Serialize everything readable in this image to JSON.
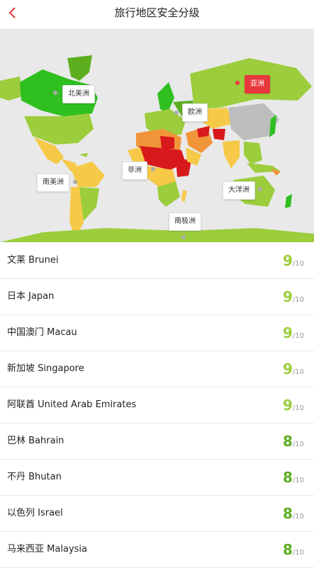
{
  "header": {
    "back_icon": "chevron-left-icon",
    "title": "旅行地区安全分级"
  },
  "colors": {
    "accent": "#e8383d",
    "safe_high": "#9ccd3c",
    "safe_mid": "#5cae1f",
    "caution": "#f7c948",
    "warning": "#f0953a",
    "danger": "#d7191c",
    "no_data": "#bdbdbd"
  },
  "map": {
    "regions": [
      {
        "label": "北美洲",
        "active": false
      },
      {
        "label": "欧洲",
        "active": false
      },
      {
        "label": "亚洲",
        "active": true
      },
      {
        "label": "非洲",
        "active": false
      },
      {
        "label": "南美洲",
        "active": false
      },
      {
        "label": "大洋洲",
        "active": false
      },
      {
        "label": "南极洲",
        "active": false
      }
    ]
  },
  "countries": [
    {
      "name": "文莱 Brunei",
      "score": "9",
      "max": "/10"
    },
    {
      "name": "日本 Japan",
      "score": "9",
      "max": "/10"
    },
    {
      "name": "中国澳门 Macau",
      "score": "9",
      "max": "/10"
    },
    {
      "name": "新加坡 Singapore",
      "score": "9",
      "max": "/10"
    },
    {
      "name": "阿联酋 United Arab Emirates",
      "score": "9",
      "max": "/10"
    },
    {
      "name": "巴林 Bahrain",
      "score": "8",
      "max": "/10"
    },
    {
      "name": "不丹 Bhutan",
      "score": "8",
      "max": "/10"
    },
    {
      "name": "以色列 Israel",
      "score": "8",
      "max": "/10"
    },
    {
      "name": "马来西亚 Malaysia",
      "score": "8",
      "max": "/10"
    }
  ]
}
